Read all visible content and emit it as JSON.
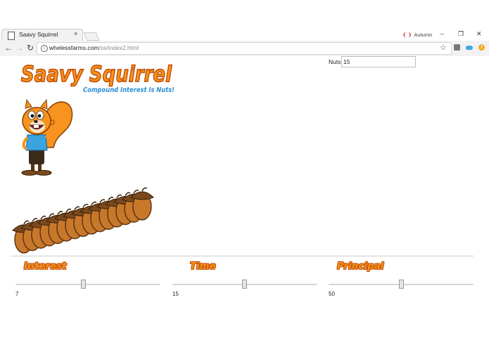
{
  "browser": {
    "tab_title": "Saavy Squirrel",
    "tab_close": "×",
    "profile_name": "Autumn",
    "url_host": "whelessfarms.com",
    "url_path": "/ss/index2.html",
    "window_controls": {
      "minimize": "–",
      "restore": "❐",
      "close": "✕"
    },
    "nav": {
      "back": "←",
      "forward": "→",
      "reload": "↻",
      "star": "☆"
    }
  },
  "header": {
    "logo_title": "Saavy Squirrel",
    "logo_subtitle": "Compound Interest Is Nuts!"
  },
  "nuts": {
    "label": "Nuts",
    "value": "15"
  },
  "acorn_count": 15,
  "controls": [
    {
      "title": "Interest",
      "value": "7",
      "fraction": 0.465
    },
    {
      "title": "Time",
      "value": "15",
      "fraction": 0.495
    },
    {
      "title": "Principal",
      "value": "50",
      "fraction": 0.5
    }
  ],
  "colors": {
    "logo_fill": "#f7931e",
    "logo_outline": "#c24d00",
    "subtitle": "#2b8fd6",
    "acorn_body": "#c8782b",
    "acorn_cap": "#7a4a1e",
    "squirrel_fur": "#f7931e",
    "shirt": "#3aa3e0"
  }
}
